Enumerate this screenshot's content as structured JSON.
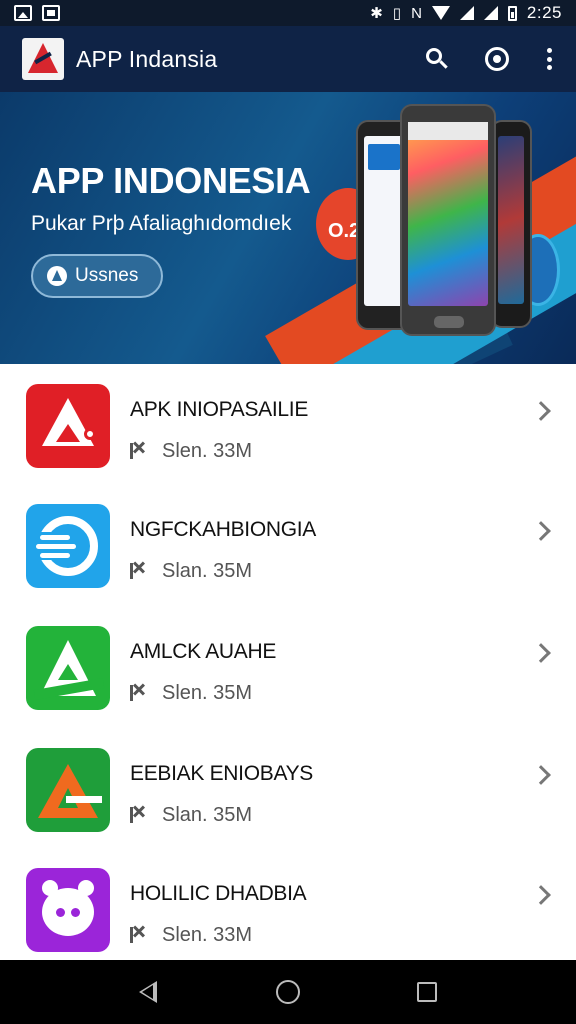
{
  "status_bar": {
    "time": "2:25",
    "icons": [
      "image-notification-icon",
      "picture-notification-icon",
      "bluetooth-icon",
      "vibrate-icon",
      "nfc-icon",
      "wifi-icon",
      "signal-icon",
      "signal-icon",
      "battery-icon"
    ]
  },
  "app_bar": {
    "title": "APP Indansia",
    "actions": [
      "search-icon",
      "record-icon",
      "overflow-menu-icon"
    ],
    "colors": {
      "background": "#0f2346"
    }
  },
  "banner": {
    "title": "APP INDONESIA",
    "subtitle": "Pukar Prþ Afaliaghıdomdıek",
    "button_label": "Ussnes",
    "badge_text": "O.2",
    "colors": {
      "primary": "#145a8e",
      "accent_red": "#e34a22",
      "accent_blue": "#1f9fd0"
    }
  },
  "apps": [
    {
      "name": "APK INIOPASAILIE",
      "meta": "Slen. 33M",
      "icon": "red-a-app-icon",
      "color": "#e01f26"
    },
    {
      "name": "NGFCKAHBIONGIA",
      "meta": "Slan. 35M",
      "icon": "blue-dash-app-icon",
      "color": "#21a4ea"
    },
    {
      "name": "AMLCK AUAHE",
      "meta": "Slen. 35M",
      "icon": "green-a-app-icon",
      "color": "#23b33a"
    },
    {
      "name": "EEBIAK ENIOBAYS",
      "meta": "Slan. 35M",
      "icon": "orange-a-app-icon",
      "color": "#1f9e3a"
    },
    {
      "name": "HOLILIC DHADBIA",
      "meta": "Slen. 33M",
      "icon": "purple-face-app-icon",
      "color": "#9b25d9"
    }
  ],
  "nav_bar": {
    "buttons": [
      "back-icon",
      "home-icon",
      "recents-icon"
    ]
  }
}
